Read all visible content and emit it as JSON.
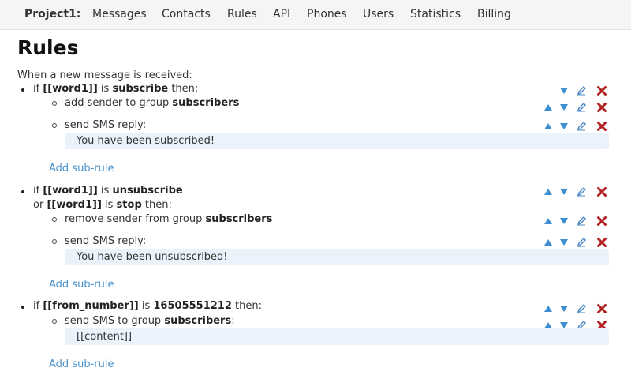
{
  "nav": {
    "brand": "Project1:",
    "links": [
      "Messages",
      "Contacts",
      "Rules",
      "API",
      "Phones",
      "Users",
      "Statistics",
      "Billing"
    ]
  },
  "page": {
    "title": "Rules",
    "intro": "When a new message is received:",
    "add_sub_rule": "Add sub-rule"
  },
  "rules": [
    {
      "cond1": {
        "pre": "if ",
        "var": "[[word1]]",
        "op": " is ",
        "val": "subscribe",
        "post": " then:"
      },
      "actions": [
        {
          "text": "add sender to group ",
          "bold": "subscribers"
        },
        {
          "text": "send SMS reply:",
          "reply": "You have been subscribed!"
        }
      ]
    },
    {
      "cond1": {
        "pre": "if ",
        "var": "[[word1]]",
        "op": " is ",
        "val": "unsubscribe"
      },
      "cond2": {
        "pre": "or ",
        "var": "[[word1]]",
        "op": " is ",
        "val": "stop",
        "post": " then:"
      },
      "actions": [
        {
          "text": "remove sender from group ",
          "bold": "subscribers"
        },
        {
          "text": "send SMS reply:",
          "reply": "You have been unsubscribed!"
        }
      ]
    },
    {
      "cond1": {
        "pre": "if ",
        "var": "[[from_number]]",
        "op": " is ",
        "val": "16505551212",
        "post": " then:"
      },
      "actions": [
        {
          "text": "send SMS to group ",
          "bold": "subscribers",
          "post": ":",
          "reply": "[[content]]"
        }
      ]
    }
  ],
  "colors": {
    "arrow": "#3d8fd1",
    "delete": "#b22222",
    "edit": "#4a86c5",
    "link": "#4a90c8",
    "reply_bg": "#eaf2fb"
  },
  "icons": {
    "up": "arrow-up-icon",
    "down": "arrow-down-icon",
    "edit": "pencil-icon",
    "delete": "delete-x-icon"
  }
}
